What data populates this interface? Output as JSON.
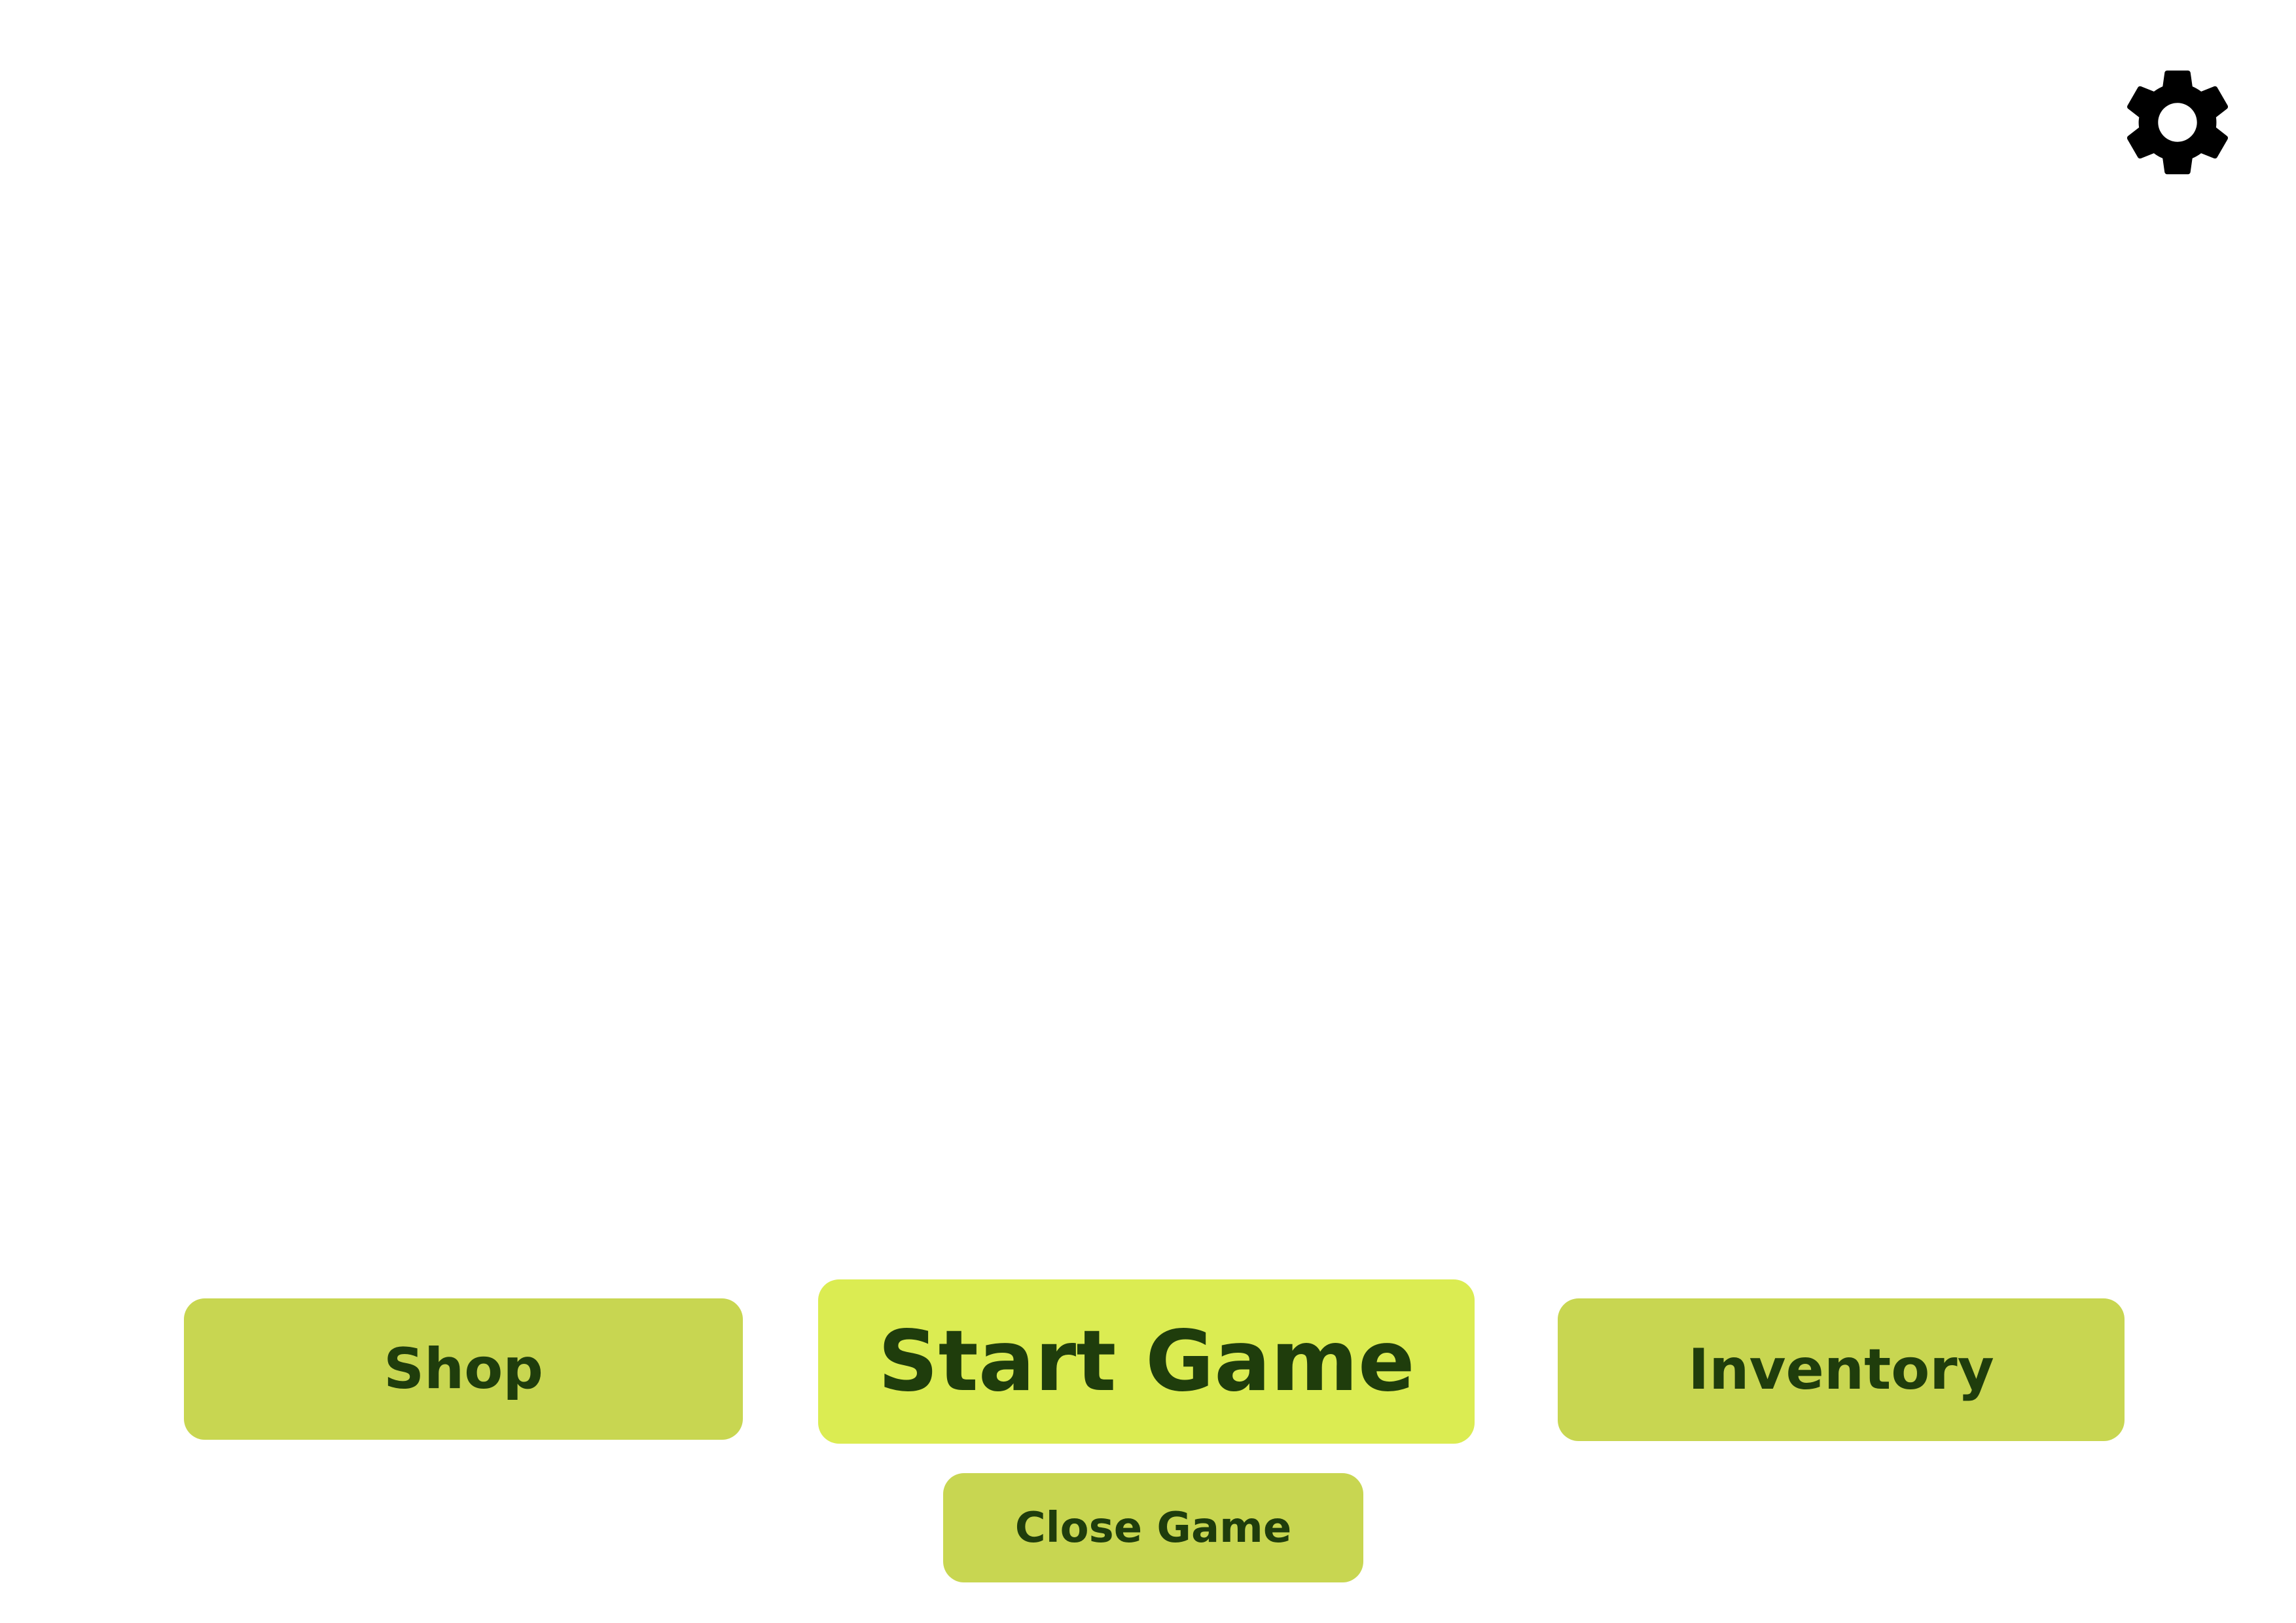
{
  "settings": {
    "icon": "gear-icon"
  },
  "menu": {
    "shop_label": "Shop",
    "start_label": "Start Game",
    "inventory_label": "Inventory",
    "close_label": "Close Game"
  },
  "colors": {
    "primary_button": "#dbec52",
    "secondary_button": "#c8d651",
    "button_text": "#1f3d0c",
    "icon": "#000000",
    "background": "#ffffff"
  }
}
